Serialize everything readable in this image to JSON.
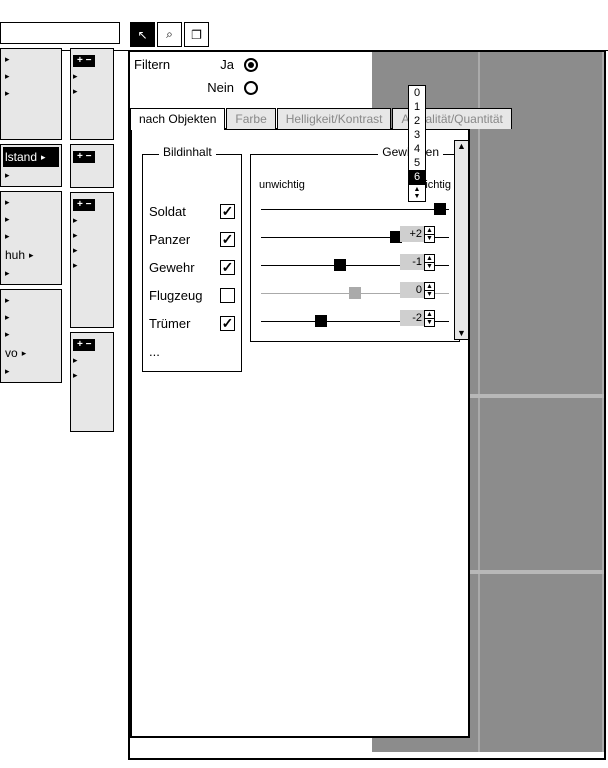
{
  "toolbar_icons": {
    "pointer": "↖",
    "zoom": "⌕",
    "windows": "❐"
  },
  "filter": {
    "label": "Filtern",
    "yes": "Ja",
    "no": "Nein",
    "value": "Ja"
  },
  "tabs": {
    "items": [
      {
        "label": "nach Objekten",
        "active": true
      },
      {
        "label": "Farbe",
        "active": false
      },
      {
        "label": "Helligkeit/Kontrast",
        "active": false
      },
      {
        "label": "Aktualität/Quantität",
        "active": false
      }
    ]
  },
  "sections": {
    "bildinhalt": "Bildinhalt",
    "gewichten": "Gewichten"
  },
  "scale_labels": {
    "left": "unwichtig",
    "right": "wichtig"
  },
  "objects": [
    {
      "name": "Soldat",
      "checked": true,
      "weight": 6,
      "slider_pos": 0.95,
      "spinner": "6"
    },
    {
      "name": "Panzer",
      "checked": true,
      "weight": 2,
      "slider_pos": 0.72,
      "spinner": "+2"
    },
    {
      "name": "Gewehr",
      "checked": true,
      "weight": -1,
      "slider_pos": 0.42,
      "spinner": "-1"
    },
    {
      "name": "Flugzeug",
      "checked": false,
      "weight": 0,
      "slider_pos": 0.5,
      "spinner": "0"
    },
    {
      "name": "Trümer",
      "checked": true,
      "weight": -2,
      "slider_pos": 0.32,
      "spinner": "-2"
    }
  ],
  "ellipsis": "...",
  "scale_strip": [
    "0",
    "1",
    "2",
    "3",
    "4",
    "5",
    "6"
  ],
  "scale_strip_hl_index": 6,
  "left_tree": [
    {
      "label": "",
      "tri": true
    },
    {
      "label": "",
      "tri": true
    },
    {
      "label": "",
      "tri": true
    },
    {
      "label": "lstand",
      "tri": true,
      "selected": true
    },
    {
      "label": "",
      "tri": true
    },
    {
      "label": "",
      "tri": true
    },
    {
      "label": "",
      "tri": true
    },
    {
      "label": "huh",
      "tri": true
    },
    {
      "label": "",
      "tri": true
    },
    {
      "label": "",
      "tri": true
    },
    {
      "label": "",
      "tri": true
    },
    {
      "label": "",
      "tri": true
    },
    {
      "label": "vo",
      "tri": true
    },
    {
      "label": "",
      "tri": true
    }
  ]
}
